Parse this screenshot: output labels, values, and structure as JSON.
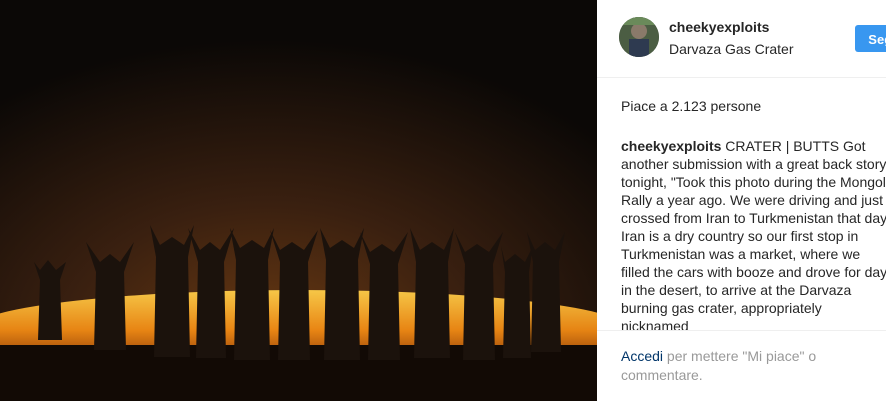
{
  "post": {
    "username": "cheekyexploits",
    "location": "Darvaza Gas Crater",
    "follow_label": "Segui",
    "likes": "Piace a 2.123 persone",
    "caption_user": "cheekyexploits",
    "caption_text": " CRATER | BUTTS Got another submission with a great back story tonight, \"Took this photo during the Mongol Rally a year ago. We were driving and just crossed from Iran to Turkmenistan that day. Iran is a dry country so our first stop in Turkmenistan was a market, where we filled the cars with booze and drove for day in the desert, to arrive at the Darvaza burning gas crater, appropriately nicknamed",
    "login_link": "Accedi",
    "login_text": " per mettere \"Mi piace\" o commentare."
  },
  "colors": {
    "follow_button": "#3897f0",
    "link": "#003569",
    "fire": "#f29a1c"
  }
}
